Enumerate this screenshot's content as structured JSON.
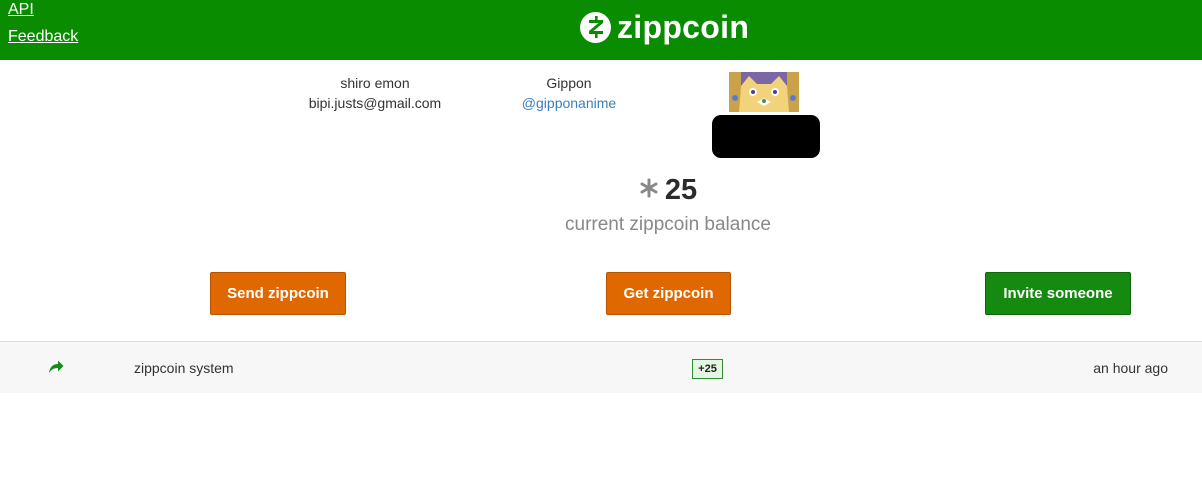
{
  "header": {
    "api_label": "API",
    "feedback_label": "Feedback",
    "logo_text": "zippcoin",
    "bg_color": "#0a8c00"
  },
  "profile": {
    "user_name": "shiro emon",
    "user_email": "bipi.justs@gmail.com",
    "display_name": "Gippon",
    "twitter_handle": "@gipponanime"
  },
  "balance": {
    "icon": "zippcoin-symbol-icon",
    "amount": "25",
    "label": "current zippcoin balance"
  },
  "actions": {
    "send_label": "Send zippcoin",
    "get_label": "Get zippcoin",
    "invite_label": "Invite someone",
    "orange_color": "#e06800",
    "green_color": "#168a10"
  },
  "transactions": [
    {
      "icon": "share-arrow-icon",
      "name": "zippcoin system",
      "amount": "+25",
      "time": "an hour ago"
    }
  ]
}
